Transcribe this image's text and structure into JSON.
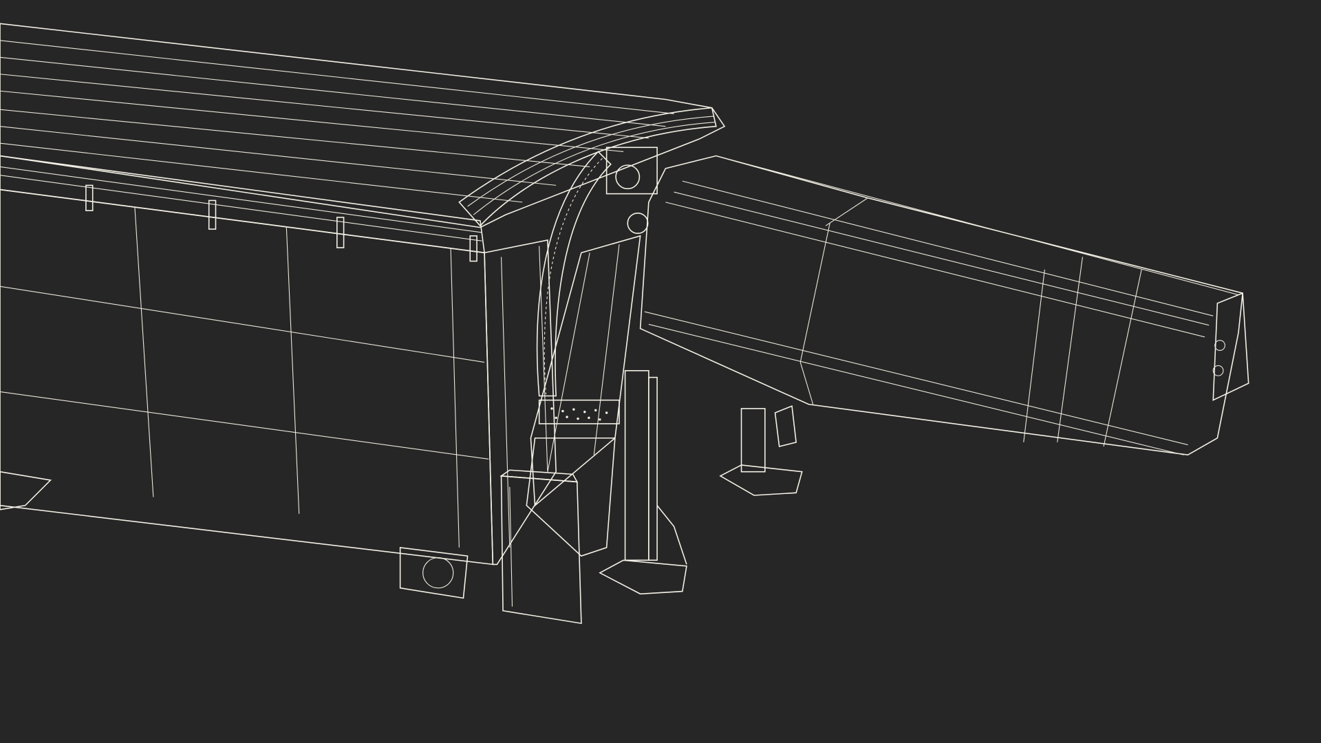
{
  "scene": {
    "subject": "",
    "render_style": "wireframe-on-shaded",
    "colors": {
      "background": "#262626",
      "surface": "#7a7a6e",
      "surface_light": "#8a8a7d",
      "surface_dark": "#66665c",
      "wire": "#f4f1e6",
      "shadow": "#3c3c36"
    }
  }
}
